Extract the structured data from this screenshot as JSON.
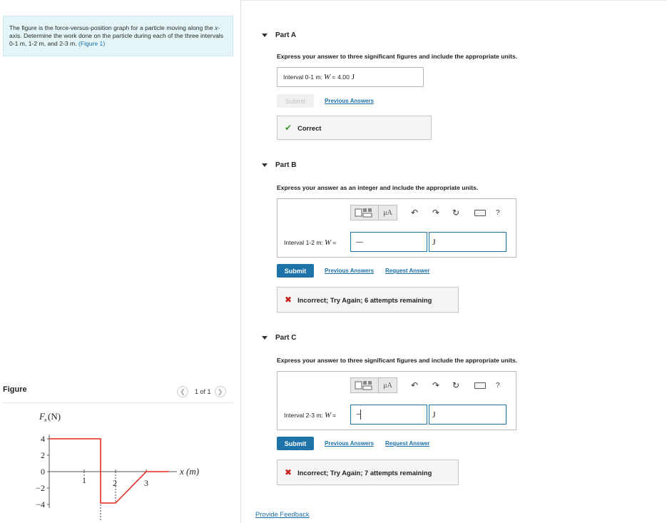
{
  "problem": {
    "text_1": "The figure is the force-versus-position graph for a particle moving along the ",
    "x_var": "x",
    "text_2": "-axis. Determine the work done on the particle during each of the three intervals 0-1 m, 1-2 m, and 2-3 m. ",
    "figure_link": "(Figure 1)"
  },
  "figure": {
    "title": "Figure",
    "pager": "1 of 1",
    "prev_icon": "chevron-left-icon",
    "next_icon": "chevron-right-icon",
    "graph": {
      "y_axis_label": "F",
      "y_axis_sub": "x",
      "y_axis_unit": " (N)",
      "x_axis_label": "x (m)",
      "y_ticks": [
        "4",
        "2",
        "0",
        "−2",
        "−4"
      ],
      "x_ticks": [
        "1",
        "2",
        "3"
      ],
      "line_color": "#e8281f"
    }
  },
  "part_a": {
    "title": "Part A",
    "instruction": "Express your answer to three significant figures and include the appropriate units.",
    "answer_label": "Interval 0-1 m: ",
    "answer_var": "W",
    "answer_eq": " = ",
    "answer_value": "4.00",
    "answer_unit": "J",
    "submit_label": "Submit",
    "previous_answers": "Previous Answers",
    "feedback": "Correct"
  },
  "part_b": {
    "title": "Part B",
    "instruction": "Express your answer as an integer and include the appropriate units.",
    "toolbar_units": "μA",
    "answer_label": "Interval 1-2 m: ",
    "answer_var": "W",
    "answer_eq": " = ",
    "answer_value": "—",
    "answer_unit": "J",
    "submit_label": "Submit",
    "previous_answers": "Previous Answers",
    "request_answer": "Request Answer",
    "feedback": "Incorrect; Try Again; 6 attempts remaining"
  },
  "part_c": {
    "title": "Part C",
    "instruction": "Express your answer to three significant figures and include the appropriate units.",
    "toolbar_units": "μA",
    "answer_label": "Interval 2-3 m: ",
    "answer_var": "W",
    "answer_eq": " = ",
    "answer_value": "−",
    "answer_unit": "J",
    "submit_label": "Submit",
    "previous_answers": "Previous Answers",
    "request_answer": "Request Answer",
    "feedback": "Incorrect; Try Again; 7 attempts remaining"
  },
  "toolbar_icons": [
    "templates-icon",
    "units-icon",
    "undo-icon",
    "redo-icon",
    "reset-icon",
    "keyboard-icon",
    "help-icon"
  ],
  "help_glyph": "?",
  "footer": {
    "provide_feedback": "Provide Feedback"
  },
  "colors": {
    "accent": "#1e74a8",
    "correct": "#3a9a2e",
    "incorrect": "#c8201c",
    "problem_bg": "#e3f5f7"
  }
}
